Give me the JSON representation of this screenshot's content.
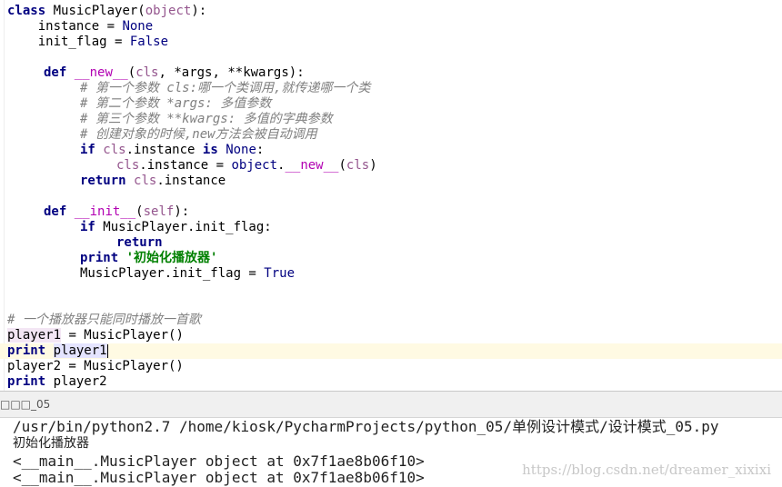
{
  "editor": {
    "l1_kw": "class",
    "l1_rest": " MusicPlayer(",
    "l1_obj": "object",
    "l1_end": "):",
    "l2_a": "    instance = ",
    "l2_b": "None",
    "l3_a": "    init_flag = ",
    "l3_b": "False",
    "l5_kw": "def",
    "l5_sp": " ",
    "l5_magic": "__new__",
    "l5_p": "(",
    "l5_cls": "cls",
    "l5_rest": ", *args, **kwargs):",
    "l6": "# 第一个参数 cls:哪一个类调用,就传递哪一个类",
    "l7": "# 第二个参数 *args: 多值参数",
    "l8": "# 第三个参数 **kwargs: 多值的字典参数",
    "l9": "# 创建对象的时候,new方法会被自动调用",
    "l10_kw": "if",
    "l10_sp": " ",
    "l10_cls": "cls",
    "l10_mid": ".instance ",
    "l10_is": "is",
    "l10_sp2": " ",
    "l10_none": "None",
    "l10_end": ":",
    "l11_cls": "cls",
    "l11_mid": ".instance = ",
    "l11_obj": "object",
    "l11_dot": ".",
    "l11_magic": "__new__",
    "l11_p": "(",
    "l11_cls2": "cls",
    "l11_end": ")",
    "l12_kw": "return",
    "l12_sp": " ",
    "l12_cls": "cls",
    "l12_rest": ".instance",
    "l14_kw": "def",
    "l14_sp": " ",
    "l14_magic": "__init__",
    "l14_p": "(",
    "l14_self": "self",
    "l14_end": "):",
    "l15_kw": "if",
    "l15_rest": " MusicPlayer.init_flag:",
    "l16_kw": "return",
    "l17_kw": "print",
    "l17_sp": " ",
    "l17_str": "'初始化播放器'",
    "l18_a": "MusicPlayer.init_flag = ",
    "l18_b": "True",
    "l20": "# 一个播放器只能同时播放一首歌",
    "l21_a": "player1",
    "l21_b": " = MusicPlayer()",
    "l22_kw": "print",
    "l22_sp": " ",
    "l22_var": "player1",
    "l23": "player2 = MusicPlayer()",
    "l24_kw": "print",
    "l24_rest": " player2"
  },
  "run": {
    "tab_label": "□□□_05",
    "cmd": "/usr/bin/python2.7 /home/kiosk/PycharmProjects/python_05/单例设计模式/设计模式_05.py",
    "out1": "初始化播放器",
    "out2": "<__main__.MusicPlayer object at 0x7f1ae8b06f10>",
    "out3": "<__main__.MusicPlayer object at 0x7f1ae8b06f10>"
  },
  "watermark": "https://blog.csdn.net/dreamer_xixixi"
}
